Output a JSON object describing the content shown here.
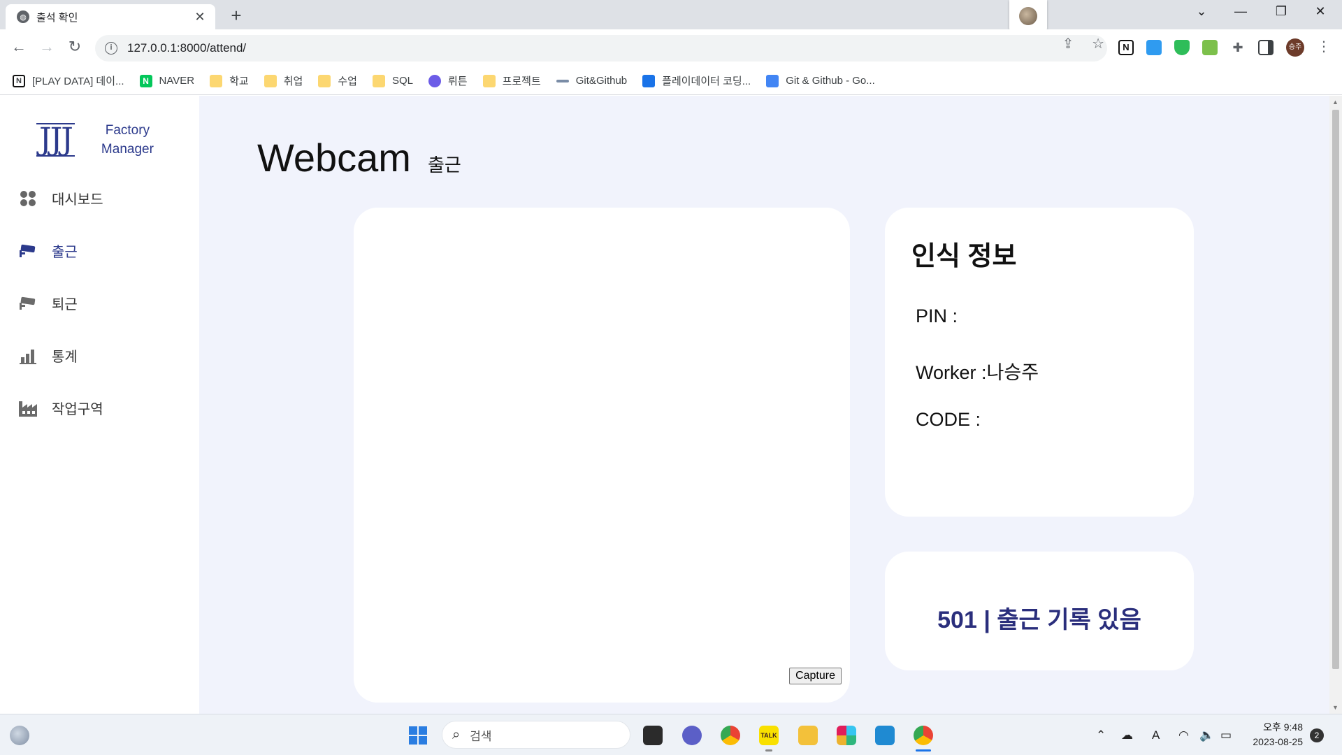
{
  "browser": {
    "tab_title": "출석 확인",
    "tab_close": "✕",
    "new_tab": "+",
    "url": "127.0.0.1:8000/attend/",
    "profile_initials": "승주"
  },
  "bookmarks": [
    {
      "label": "[PLAY DATA] 데이...",
      "icon": "notion-icon"
    },
    {
      "label": "NAVER",
      "icon": "naver-icon"
    },
    {
      "label": "학교",
      "icon": "folder-icon"
    },
    {
      "label": "취업",
      "icon": "folder-icon"
    },
    {
      "label": "수업",
      "icon": "folder-icon"
    },
    {
      "label": "SQL",
      "icon": "folder-icon"
    },
    {
      "label": "뤼튼",
      "icon": "wrtn-icon"
    },
    {
      "label": "프로젝트",
      "icon": "folder-icon"
    },
    {
      "label": "Git&Github",
      "icon": "link-icon"
    },
    {
      "label": "플레이데이터 코딩...",
      "icon": "playdata-icon"
    },
    {
      "label": "Git & Github - Go...",
      "icon": "google-docs-icon"
    }
  ],
  "sidebar": {
    "logo_mark": "JJJ",
    "logo_line1": "Factory",
    "logo_line2": "Manager",
    "items": [
      {
        "label": "대시보드",
        "icon": "dashboard-icon"
      },
      {
        "label": "출근",
        "icon": "cctv-icon",
        "active": true
      },
      {
        "label": "퇴근",
        "icon": "cctv-icon"
      },
      {
        "label": "통계",
        "icon": "bar-chart-icon"
      },
      {
        "label": "작업구역",
        "icon": "factory-icon"
      }
    ]
  },
  "main": {
    "title": "Webcam",
    "subtitle": "출근",
    "capture_label": "Capture",
    "info": {
      "heading": "인식 정보",
      "pin": "PIN :",
      "worker": "Worker :나승주",
      "code": "CODE :"
    },
    "status_message": "501 | 출근 기록 있음"
  },
  "taskbar": {
    "search_placeholder": "검색",
    "time": "오후 9:48",
    "date": "2023-08-25",
    "notifications": "2",
    "ime": "A"
  },
  "colors": {
    "accent": "#2c3a8c",
    "page_bg": "#f1f3fc",
    "status_text": "#2a2e7c"
  }
}
